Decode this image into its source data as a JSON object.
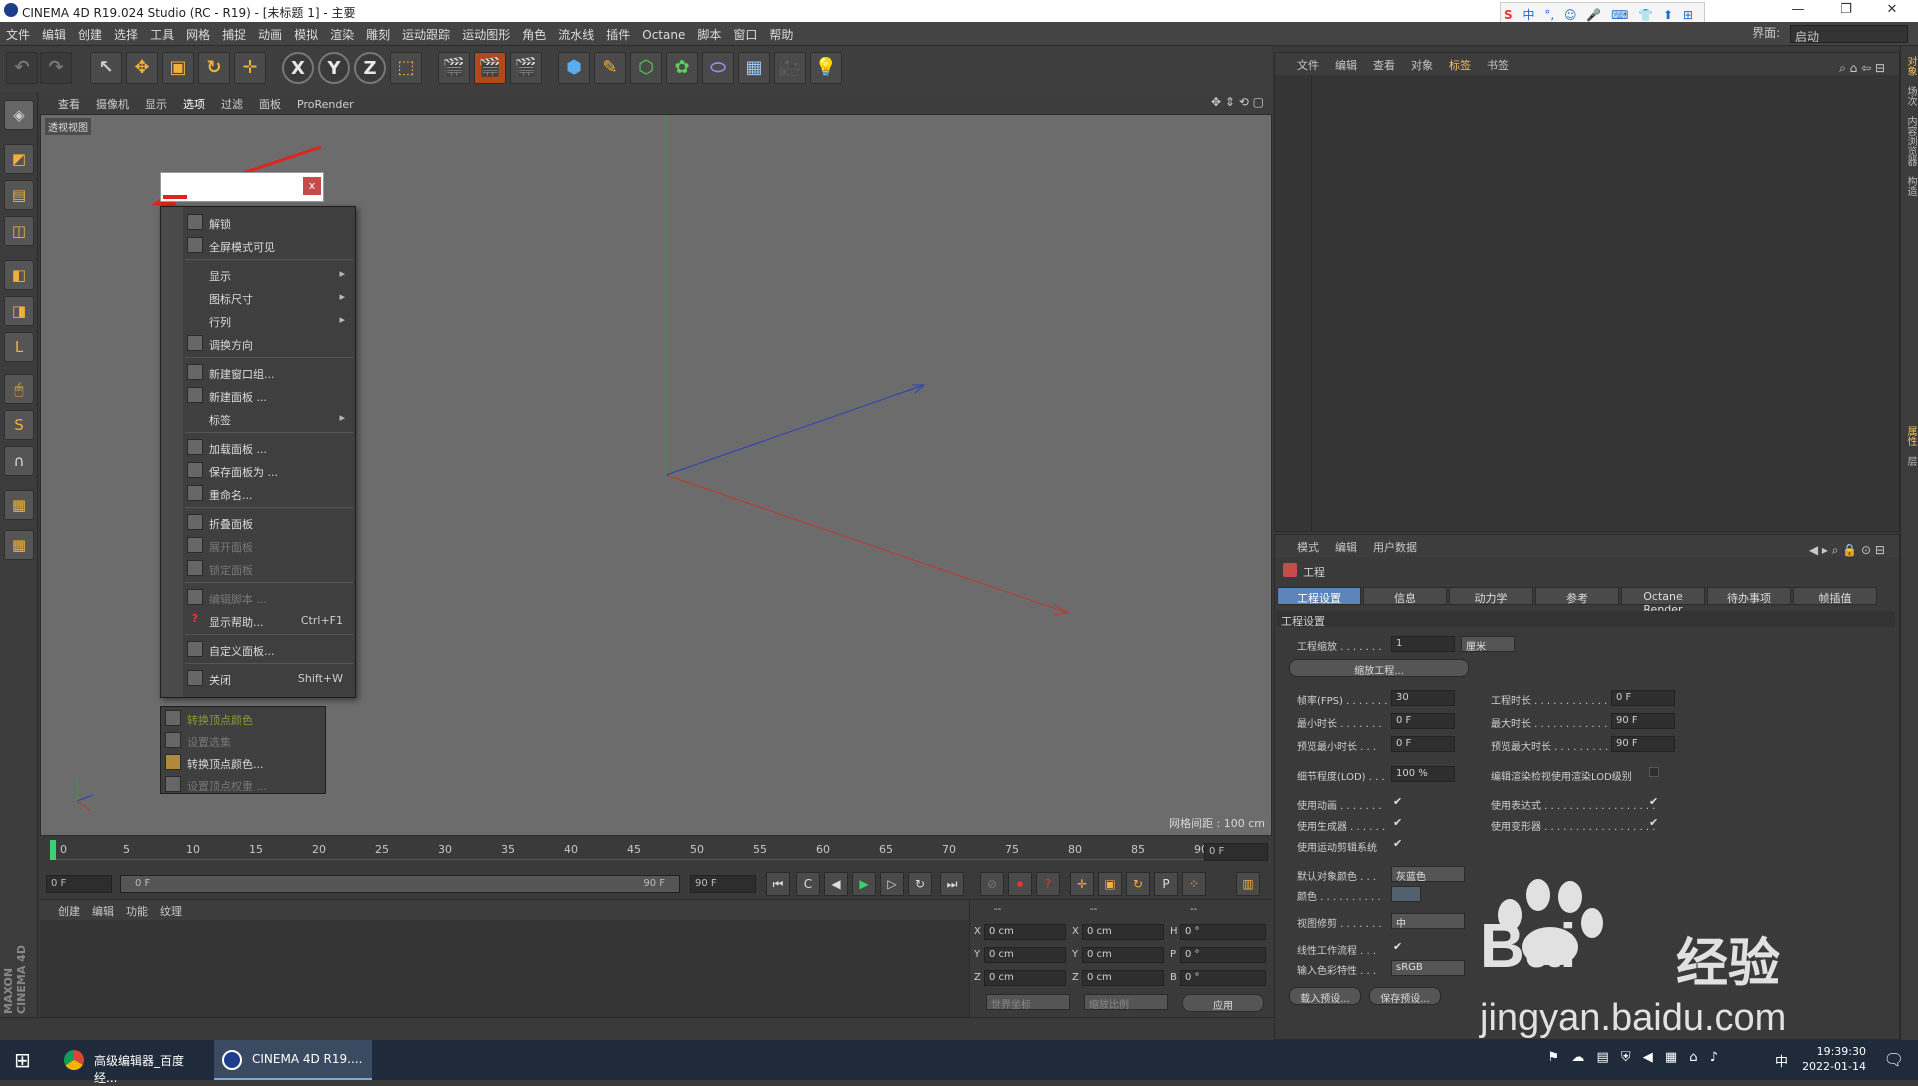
{
  "window": {
    "title": "CINEMA 4D R19.024 Studio (RC - R19) - [未标题 1] - 主要",
    "minimize": "—",
    "restore": "❐",
    "close": "✕"
  },
  "ime": {
    "items": [
      "S",
      "中",
      "°,",
      "☺",
      "🎤",
      "⌨",
      "👕",
      "⬆",
      "⊞"
    ]
  },
  "menubar": {
    "items": [
      "文件",
      "编辑",
      "创建",
      "选择",
      "工具",
      "网格",
      "捕捉",
      "动画",
      "模拟",
      "渲染",
      "雕刻",
      "运动跟踪",
      "运动图形",
      "角色",
      "流水线",
      "插件",
      "Octane",
      "脚本",
      "窗口",
      "帮助"
    ],
    "layout_label": "界面:",
    "layout_value": "启动"
  },
  "toolbar": {
    "tools": [
      "↶",
      "↷",
      "↖",
      "✥",
      "▣",
      "↻",
      "✛",
      "X",
      "Y",
      "Z",
      "⬚",
      "🎬",
      "🎬",
      "🎬",
      "⬢",
      "✎",
      "⬡",
      "✿",
      "⬭",
      "▦",
      "🎥",
      "💡"
    ]
  },
  "viewport": {
    "menu": [
      "查看",
      "摄像机",
      "显示",
      "选项",
      "过滤",
      "面板",
      "ProRender"
    ],
    "label": "透视视图",
    "grid_info": "网格间距 : 100 cm"
  },
  "left_tools": [
    "◈",
    "◩",
    "▤",
    "◫",
    "◧",
    "◨",
    "L",
    "🖱",
    "S",
    "∩",
    "▦",
    "▦"
  ],
  "context_menu": {
    "items": [
      {
        "label": "解锁",
        "shortcut": "",
        "arrow": false,
        "disabled": false
      },
      {
        "label": "全屏模式可见",
        "shortcut": "",
        "arrow": false,
        "disabled": false
      },
      {
        "label": "显示",
        "shortcut": "",
        "arrow": true,
        "disabled": false
      },
      {
        "label": "图标尺寸",
        "shortcut": "",
        "arrow": true,
        "disabled": false
      },
      {
        "label": "行列",
        "shortcut": "",
        "arrow": true,
        "disabled": false
      },
      {
        "label": "调换方向",
        "shortcut": "",
        "arrow": false,
        "disabled": false
      },
      {
        "label": "新建窗口组...",
        "shortcut": "",
        "arrow": false,
        "disabled": false
      },
      {
        "label": "新建面板 ...",
        "shortcut": "",
        "arrow": false,
        "disabled": false
      },
      {
        "label": "标签",
        "shortcut": "",
        "arrow": true,
        "disabled": false
      },
      {
        "label": "加载面板 ...",
        "shortcut": "",
        "arrow": false,
        "disabled": false
      },
      {
        "label": "保存面板为 ...",
        "shortcut": "",
        "arrow": false,
        "disabled": false
      },
      {
        "label": "重命名...",
        "shortcut": "",
        "arrow": false,
        "disabled": false
      },
      {
        "label": "折叠面板",
        "shortcut": "",
        "arrow": false,
        "disabled": false
      },
      {
        "label": "展开面板",
        "shortcut": "",
        "arrow": false,
        "disabled": true
      },
      {
        "label": "锁定面板",
        "shortcut": "",
        "arrow": false,
        "disabled": true
      },
      {
        "label": "编辑脚本 ...",
        "shortcut": "",
        "arrow": false,
        "disabled": true
      },
      {
        "label": "显示帮助...",
        "shortcut": "Ctrl+F1",
        "arrow": false,
        "disabled": false
      },
      {
        "label": "自定义面板...",
        "shortcut": "",
        "arrow": false,
        "disabled": false
      },
      {
        "label": "关闭",
        "shortcut": "Shift+W",
        "arrow": false,
        "disabled": false
      }
    ],
    "close_x": "x"
  },
  "submenu2": {
    "items": [
      {
        "label": "转换顶点颜色",
        "disabled": true
      },
      {
        "label": "设置选集",
        "disabled": true
      },
      {
        "label": "转换顶点颜色...",
        "disabled": false
      },
      {
        "label": "设置顶点权重 ...",
        "disabled": true
      }
    ]
  },
  "timeline": {
    "ticks": [
      "0",
      "5",
      "10",
      "15",
      "20",
      "25",
      "30",
      "35",
      "40",
      "45",
      "50",
      "55",
      "60",
      "65",
      "70",
      "75",
      "80",
      "85",
      "90"
    ],
    "current_frame": "0 F",
    "start_field": "0 F",
    "range_start": "0 F",
    "range_end": "90 F",
    "end_field": "90 F",
    "transport": [
      "⏮",
      "C",
      "◀",
      "▶",
      "▷",
      "↻",
      "⏭"
    ],
    "record": [
      "⊘",
      "⏺",
      "?",
      "✛",
      "▣",
      "↻",
      "P",
      "⁘"
    ]
  },
  "material_panel": {
    "menu": [
      "创建",
      "编辑",
      "功能",
      "纹理"
    ]
  },
  "coord_panel": {
    "headers": [
      "--",
      "--",
      "--"
    ],
    "rows": [
      {
        "a": "X",
        "av": "0 cm",
        "b": "X",
        "bv": "0 cm",
        "c": "H",
        "cv": "0 °"
      },
      {
        "a": "Y",
        "av": "0 cm",
        "b": "Y",
        "bv": "0 cm",
        "c": "P",
        "cv": "0 °"
      },
      {
        "a": "Z",
        "av": "0 cm",
        "b": "Z",
        "bv": "0 cm",
        "c": "B",
        "cv": "0 °"
      }
    ],
    "world_coord": "世界坐标",
    "scale_ratio": "缩放比例",
    "apply": "应用"
  },
  "object_panel": {
    "menu": [
      "文件",
      "编辑",
      "查看",
      "对象",
      "标签",
      "书签"
    ]
  },
  "attr_panel": {
    "menu": [
      "模式",
      "编辑",
      "用户数据"
    ],
    "object_name": "工程",
    "tabs": [
      "工程设置",
      "信息",
      "动力学",
      "参考",
      "Octane Render",
      "待办事项",
      "帧插值"
    ],
    "section": "工程设置",
    "fields": {
      "project_scale_label": "工程缩放 . . . . . . .",
      "project_scale_value": "1",
      "project_scale_unit": "厘米",
      "scale_project_btn": "缩放工程...",
      "fps_label": "帧率(FPS) . . . . . . .",
      "fps_value": "30",
      "project_time_label": "工程时长 . . . . . . . . . . . . . . . . . . .",
      "project_time_value": "0 F",
      "min_time_label": "最小时长 . . . . . . .",
      "min_time_value": "0 F",
      "max_time_label": "最大时长 . . . . . . . . . . . . . . . . . . .",
      "max_time_value": "90 F",
      "prev_min_label": "预览最小时长 . . .",
      "prev_min_value": "0 F",
      "prev_max_label": "预览最大时长 . . . . . . . . . . . . . . . . .",
      "prev_max_value": "90 F",
      "lod_label": "细节程度(LOD) . . .",
      "lod_value": "100 %",
      "lod_render_label": "编辑渲染检视使用渲染LOD级别",
      "use_anim_label": "使用动画 . . . . . . .",
      "use_expr_label": "使用表达式 . . . . . . . . . . . . . . . . . .",
      "use_gen_label": "使用生成器 . . . . . .",
      "use_deform_label": "使用变形器 . . . . . . . . . . . . . . . . . .",
      "use_motion_label": "使用运动剪辑系统",
      "default_color_label": "默认对象颜色 . . .",
      "default_color_value": "灰蓝色",
      "color_label": "颜色 . . . . . . . . . .",
      "view_clip_label": "视图修剪 . . . . . . .",
      "view_clip_value": "中",
      "linear_label": "线性工作流程 . . .",
      "input_color_label": "输入色彩特性 . . .",
      "input_color_value": "sRGB",
      "load_preset": "载入预设...",
      "save_preset": "保存预设..."
    },
    "check": "✔"
  },
  "right_strip": [
    "对象",
    "场次",
    "内容浏览器",
    "构造",
    "属性",
    "层"
  ],
  "taskbar": {
    "start": "⊞",
    "tasks": [
      "高级编辑器_百度经...",
      "CINEMA 4D R19...."
    ],
    "time": "19:39:30",
    "date": "2022-01-14",
    "ime": "中"
  },
  "watermark": {
    "brand": "Bai",
    "brand2": "经验",
    "url": "jingyan.baidu.com"
  },
  "maxon": "MAXON CINEMA 4D",
  "colors": {
    "accent_tab": "#5b84b8",
    "axis_red": "#c0392b",
    "axis_blue": "#2b3fbf",
    "axis_green": "#2e9e3b"
  }
}
